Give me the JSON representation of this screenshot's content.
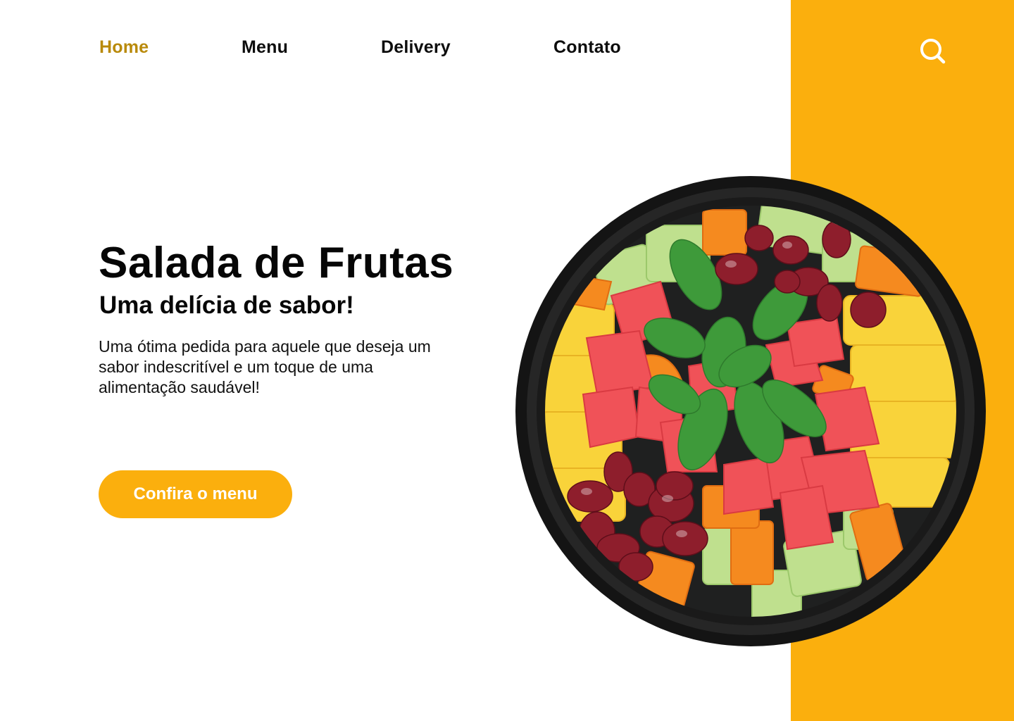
{
  "nav": {
    "items": [
      {
        "label": "Home",
        "active": true
      },
      {
        "label": "Menu",
        "active": false
      },
      {
        "label": "Delivery",
        "active": false
      },
      {
        "label": "Contato",
        "active": false
      }
    ],
    "search_icon": "search-icon"
  },
  "hero": {
    "title": "Salada de Frutas",
    "subtitle": "Uma delícia de sabor!",
    "description": "Uma ótima pedida para aquele que deseja um sabor indescritível e um toque de uma alimentação saudável!",
    "cta_label": "Confira o menu"
  },
  "colors": {
    "accent": "#FBAF0D",
    "active_nav": "#B98A0B",
    "text": "#060606",
    "background": "#FFFFFF"
  }
}
